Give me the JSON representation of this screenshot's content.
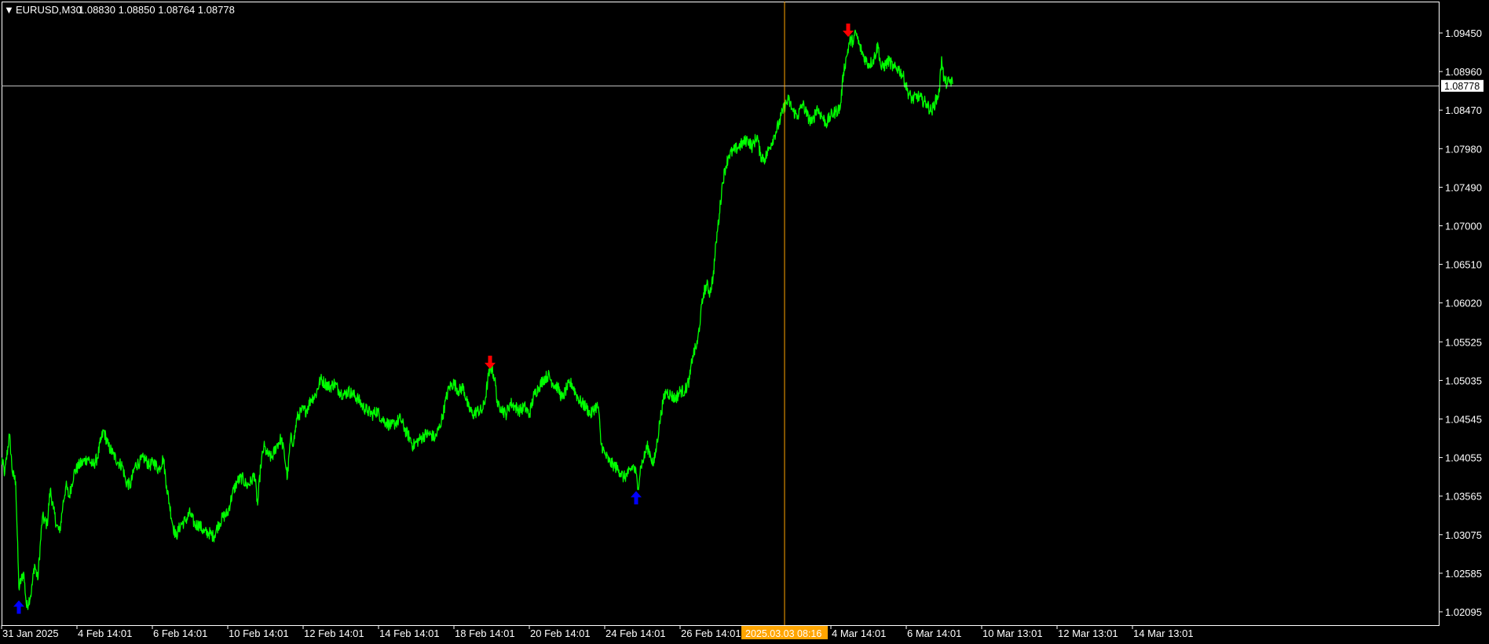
{
  "header": {
    "menu_glyph": "▼",
    "symbol": "EURUSD,M30",
    "ohlc": "1.08830 1.08850 1.08764 1.08778"
  },
  "crosshair": {
    "price_label": "1.08778",
    "price": 1.08778,
    "time_label": "2025.03.03 08:16"
  },
  "colors": {
    "background": "#000000",
    "price_line": "#00ff00",
    "axis": "#ffffff",
    "crosshair_vertical": "#ffa500",
    "crosshair_horizontal": "#c8c8c8",
    "time_tag_bg": "#ffa500",
    "price_tag_bg": "#ffffff",
    "up_arrow": "#0000ff",
    "down_arrow": "#ff0000"
  },
  "icons": {
    "buy_signal": "up-arrow-icon",
    "sell_signal": "down-arrow-icon",
    "menu": "triangle-down-icon"
  },
  "chart_data": {
    "type": "line",
    "title": "EURUSD,M30",
    "xlabel": "",
    "ylabel": "",
    "grid": false,
    "ylim": [
      1.0184,
      1.0982
    ],
    "y_ticks": [
      "1.09450",
      "1.08960",
      "1.08470",
      "1.07980",
      "1.07490",
      "1.07000",
      "1.06510",
      "1.06020",
      "1.05525",
      "1.05035",
      "1.04545",
      "1.04055",
      "1.03565",
      "1.03075",
      "1.02585",
      "1.02095"
    ],
    "x_ticks": [
      "31 Jan 2025",
      "4 Feb 14:01",
      "6 Feb 14:01",
      "10 Feb 14:01",
      "12 Feb 14:01",
      "14 Feb 14:01",
      "18 Feb 14:01",
      "20 Feb 14:01",
      "24 Feb 14:01",
      "26 Feb 14:01",
      "4 Mar 14:01",
      "6 Mar 14:01",
      "10 Mar 13:01",
      "12 Mar 13:01",
      "14 Mar 13:01"
    ],
    "series": [
      {
        "points": [
          [
            0,
            1.0405
          ],
          [
            4,
            1.0385
          ],
          [
            10,
            1.0435
          ],
          [
            14,
            1.0385
          ],
          [
            18,
            1.0375
          ],
          [
            22,
            1.024
          ],
          [
            28,
            1.026
          ],
          [
            32,
            1.0215
          ],
          [
            38,
            1.0235
          ],
          [
            42,
            1.027
          ],
          [
            46,
            1.025
          ],
          [
            52,
            1.033
          ],
          [
            58,
            1.032
          ],
          [
            62,
            1.0365
          ],
          [
            66,
            1.034
          ],
          [
            70,
            1.032
          ],
          [
            74,
            1.031
          ],
          [
            78,
            1.0345
          ],
          [
            82,
            1.037
          ],
          [
            86,
            1.0355
          ],
          [
            92,
            1.0385
          ],
          [
            98,
            1.0395
          ],
          [
            104,
            1.04
          ],
          [
            110,
            1.0405
          ],
          [
            116,
            1.0395
          ],
          [
            122,
            1.0405
          ],
          [
            126,
            1.0425
          ],
          [
            130,
            1.044
          ],
          [
            136,
            1.042
          ],
          [
            142,
            1.041
          ],
          [
            148,
            1.04
          ],
          [
            154,
            1.0395
          ],
          [
            158,
            1.0375
          ],
          [
            164,
            1.037
          ],
          [
            170,
            1.0395
          ],
          [
            176,
            1.04
          ],
          [
            182,
            1.0405
          ],
          [
            188,
            1.0395
          ],
          [
            194,
            1.04
          ],
          [
            200,
            1.039
          ],
          [
            206,
            1.0405
          ],
          [
            210,
            1.037
          ],
          [
            214,
            1.0345
          ],
          [
            218,
            1.032
          ],
          [
            222,
            1.0305
          ],
          [
            228,
            1.032
          ],
          [
            234,
            1.0325
          ],
          [
            240,
            1.0335
          ],
          [
            246,
            1.032
          ],
          [
            252,
            1.032
          ],
          [
            258,
            1.031
          ],
          [
            264,
            1.031
          ],
          [
            270,
            1.0305
          ],
          [
            276,
            1.032
          ],
          [
            282,
            1.033
          ],
          [
            288,
            1.0335
          ],
          [
            294,
            1.036
          ],
          [
            300,
            1.0375
          ],
          [
            306,
            1.038
          ],
          [
            312,
            1.037
          ],
          [
            318,
            1.0375
          ],
          [
            322,
            1.0385
          ],
          [
            326,
            1.0345
          ],
          [
            330,
            1.0395
          ],
          [
            334,
            1.042
          ],
          [
            338,
            1.041
          ],
          [
            344,
            1.0405
          ],
          [
            350,
            1.042
          ],
          [
            356,
            1.043
          ],
          [
            360,
            1.041
          ],
          [
            364,
            1.038
          ],
          [
            368,
            1.043
          ],
          [
            372,
            1.0425
          ],
          [
            376,
            1.0455
          ],
          [
            382,
            1.0465
          ],
          [
            388,
            1.0465
          ],
          [
            394,
            1.048
          ],
          [
            400,
            1.0485
          ],
          [
            406,
            1.0505
          ],
          [
            412,
            1.05
          ],
          [
            418,
            1.0495
          ],
          [
            424,
            1.05
          ],
          [
            430,
            1.049
          ],
          [
            436,
            1.0485
          ],
          [
            442,
            1.049
          ],
          [
            448,
            1.0485
          ],
          [
            454,
            1.048
          ],
          [
            460,
            1.047
          ],
          [
            466,
            1.0465
          ],
          [
            472,
            1.046
          ],
          [
            478,
            1.0465
          ],
          [
            484,
            1.0455
          ],
          [
            490,
            1.045
          ],
          [
            496,
            1.0445
          ],
          [
            502,
            1.045
          ],
          [
            508,
            1.0455
          ],
          [
            514,
            1.044
          ],
          [
            520,
            1.043
          ],
          [
            524,
            1.042
          ],
          [
            528,
            1.0425
          ],
          [
            534,
            1.043
          ],
          [
            540,
            1.0435
          ],
          [
            546,
            1.0435
          ],
          [
            552,
            1.043
          ],
          [
            558,
            1.0445
          ],
          [
            562,
            1.046
          ],
          [
            566,
            1.048
          ],
          [
            570,
            1.0495
          ],
          [
            576,
            1.05
          ],
          [
            582,
            1.049
          ],
          [
            588,
            1.0495
          ],
          [
            594,
            1.047
          ],
          [
            600,
            1.046
          ],
          [
            606,
            1.0465
          ],
          [
            612,
            1.0465
          ],
          [
            616,
            1.048
          ],
          [
            620,
            1.051
          ],
          [
            624,
            1.052
          ],
          [
            628,
            1.0505
          ],
          [
            632,
            1.047
          ],
          [
            636,
            1.047
          ],
          [
            642,
            1.046
          ],
          [
            648,
            1.0475
          ],
          [
            654,
            1.047
          ],
          [
            660,
            1.0465
          ],
          [
            666,
            1.047
          ],
          [
            672,
            1.046
          ],
          [
            678,
            1.0485
          ],
          [
            684,
            1.0495
          ],
          [
            690,
            1.0505
          ],
          [
            696,
            1.051
          ],
          [
            702,
            1.05
          ],
          [
            708,
            1.0495
          ],
          [
            714,
            1.048
          ],
          [
            720,
            1.0495
          ],
          [
            726,
            1.05
          ],
          [
            732,
            1.0485
          ],
          [
            738,
            1.0475
          ],
          [
            744,
            1.047
          ],
          [
            750,
            1.046
          ],
          [
            756,
            1.047
          ],
          [
            760,
            1.047
          ],
          [
            763,
            1.0425
          ],
          [
            768,
            1.041
          ],
          [
            774,
            1.04
          ],
          [
            780,
            1.0395
          ],
          [
            786,
            1.039
          ],
          [
            792,
            1.038
          ],
          [
            798,
            1.0385
          ],
          [
            804,
            1.0395
          ],
          [
            808,
            1.0385
          ],
          [
            810,
            1.0365
          ],
          [
            814,
            1.0395
          ],
          [
            818,
            1.0405
          ],
          [
            822,
            1.042
          ],
          [
            826,
            1.041
          ],
          [
            830,
            1.0395
          ],
          [
            834,
            1.042
          ],
          [
            838,
            1.045
          ],
          [
            842,
            1.0475
          ],
          [
            846,
            1.049
          ],
          [
            852,
            1.0485
          ],
          [
            858,
            1.048
          ],
          [
            864,
            1.049
          ],
          [
            870,
            1.049
          ],
          [
            876,
            1.0505
          ],
          [
            880,
            1.0535
          ],
          [
            886,
            1.055
          ],
          [
            890,
            1.0585
          ],
          [
            894,
            1.0615
          ],
          [
            898,
            1.0625
          ],
          [
            902,
            1.0615
          ],
          [
            906,
            1.0635
          ],
          [
            910,
            1.068
          ],
          [
            914,
            1.0715
          ],
          [
            918,
            1.0755
          ],
          [
            922,
            1.0775
          ],
          [
            926,
            1.079
          ],
          [
            932,
            1.0795
          ],
          [
            938,
            1.08
          ],
          [
            944,
            1.0805
          ],
          [
            950,
            1.081
          ],
          [
            956,
            1.08
          ],
          [
            962,
            1.0815
          ],
          [
            966,
            1.079
          ],
          [
            972,
            1.0785
          ],
          [
            978,
            1.08
          ],
          [
            984,
            1.0815
          ],
          [
            990,
            1.083
          ],
          [
            996,
            1.085
          ],
          [
            1002,
            1.086
          ],
          [
            1008,
            1.0845
          ],
          [
            1014,
            1.084
          ],
          [
            1020,
            1.0855
          ],
          [
            1026,
            1.084
          ],
          [
            1032,
            1.083
          ],
          [
            1038,
            1.085
          ],
          [
            1044,
            1.084
          ],
          [
            1050,
            1.083
          ],
          [
            1056,
            1.084
          ],
          [
            1062,
            1.0845
          ],
          [
            1068,
            1.085
          ],
          [
            1072,
            1.0895
          ],
          [
            1076,
            1.0915
          ],
          [
            1080,
            1.0935
          ],
          [
            1084,
            1.0935
          ],
          [
            1088,
            1.0945
          ],
          [
            1092,
            1.093
          ],
          [
            1098,
            1.0915
          ],
          [
            1104,
            1.0905
          ],
          [
            1110,
            1.091
          ],
          [
            1116,
            1.093
          ],
          [
            1120,
            1.09
          ],
          [
            1126,
            1.0905
          ],
          [
            1130,
            1.091
          ],
          [
            1136,
            1.09
          ],
          [
            1142,
            1.09
          ],
          [
            1148,
            1.089
          ],
          [
            1154,
            1.087
          ],
          [
            1160,
            1.086
          ],
          [
            1166,
            1.0865
          ],
          [
            1172,
            1.086
          ],
          [
            1178,
            1.0855
          ],
          [
            1184,
            1.0845
          ],
          [
            1190,
            1.086
          ],
          [
            1194,
            1.087
          ],
          [
            1197,
            1.0915
          ],
          [
            1200,
            1.0885
          ],
          [
            1204,
            1.088
          ],
          [
            1208,
            1.0885
          ],
          [
            1211,
            1.088
          ]
        ]
      }
    ],
    "markers": [
      {
        "type": "up",
        "x": 22,
        "y": 1.0214,
        "name": "buy-signal-1"
      },
      {
        "type": "down",
        "x": 622,
        "y": 1.0528,
        "name": "sell-signal-1"
      },
      {
        "type": "up",
        "x": 808,
        "y": 1.0353,
        "name": "buy-signal-2"
      },
      {
        "type": "down",
        "x": 1078,
        "y": 1.095,
        "name": "sell-signal-2"
      }
    ]
  }
}
